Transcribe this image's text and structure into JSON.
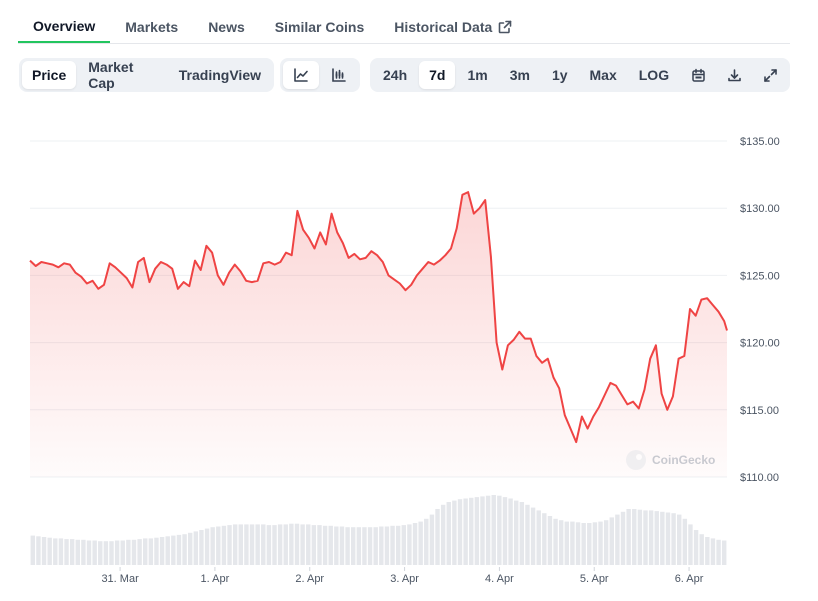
{
  "tabs": [
    {
      "label": "Overview",
      "active": true
    },
    {
      "label": "Markets"
    },
    {
      "label": "News"
    },
    {
      "label": "Similar Coins"
    },
    {
      "label": "Historical Data",
      "icon": "external-link-icon"
    }
  ],
  "chart_type_toggle": [
    "Price",
    "Market Cap",
    "TradingView"
  ],
  "chart_style_icons": [
    "line-chart-icon",
    "candlestick-chart-icon"
  ],
  "ranges": [
    "24h",
    "7d",
    "1m",
    "3m",
    "1y",
    "Max",
    "LOG"
  ],
  "selected_range": "7d",
  "tool_icons": [
    "calendar-icon",
    "download-icon",
    "expand-icon"
  ],
  "watermark": "CoinGecko",
  "colors": {
    "line": "#ef4444",
    "accent": "#22c55e",
    "volume": "#e5e7eb"
  },
  "chart_data": {
    "type": "area",
    "y_ticks": [
      "$135.00",
      "$130.00",
      "$125.00",
      "$120.00",
      "$115.00",
      "$110.00"
    ],
    "ylim": [
      110,
      135
    ],
    "x_ticks": [
      "31. Mar",
      "1. Apr",
      "2. Apr",
      "3. Apr",
      "4. Apr",
      "5. Apr",
      "6. Apr"
    ],
    "x_tick_positions_days": [
      0.95,
      1.95,
      2.95,
      3.95,
      4.95,
      5.95,
      6.95
    ],
    "x_range_days": [
      0.0,
      7.35
    ],
    "grid": true,
    "series": [
      {
        "x": [
          0.0,
          0.06,
          0.12,
          0.18,
          0.24,
          0.3,
          0.36,
          0.42,
          0.48,
          0.54,
          0.6,
          0.66,
          0.72,
          0.78,
          0.84,
          0.9,
          0.96,
          1.02,
          1.08,
          1.14,
          1.2,
          1.26,
          1.32,
          1.38,
          1.44,
          1.5,
          1.56,
          1.62,
          1.68,
          1.74,
          1.8,
          1.86,
          1.92,
          1.98,
          2.04,
          2.1,
          2.16,
          2.22,
          2.28,
          2.34,
          2.4,
          2.46,
          2.52,
          2.58,
          2.64,
          2.7,
          2.76,
          2.82,
          2.88,
          2.94,
          3.0,
          3.06,
          3.12,
          3.18,
          3.24,
          3.3,
          3.36,
          3.42,
          3.48,
          3.54,
          3.6,
          3.66,
          3.72,
          3.78,
          3.84,
          3.9,
          3.96,
          4.02,
          4.08,
          4.14,
          4.2,
          4.26,
          4.32,
          4.38,
          4.44,
          4.5,
          4.56,
          4.62,
          4.68,
          4.74,
          4.8,
          4.86,
          4.92,
          4.98,
          5.04,
          5.1,
          5.16,
          5.22,
          5.28,
          5.34,
          5.4,
          5.46,
          5.52,
          5.58,
          5.64,
          5.7,
          5.76,
          5.82,
          5.88,
          5.94,
          6.0,
          6.06,
          6.12,
          6.18,
          6.24,
          6.3,
          6.36,
          6.42,
          6.48,
          6.54,
          6.6,
          6.66,
          6.72,
          6.78,
          6.84,
          6.9,
          6.96,
          7.02,
          7.08,
          7.14,
          7.2,
          7.26,
          7.32,
          7.35
        ],
        "values": [
          126.1,
          125.7,
          126.0,
          125.9,
          125.8,
          125.6,
          125.9,
          125.8,
          125.2,
          124.9,
          124.4,
          124.6,
          124.0,
          124.3,
          125.9,
          125.6,
          125.2,
          124.8,
          124.1,
          126.0,
          126.3,
          124.5,
          125.5,
          126.0,
          125.8,
          125.5,
          124.0,
          124.5,
          124.2,
          126.1,
          125.4,
          127.2,
          126.7,
          125.0,
          124.3,
          125.2,
          125.8,
          125.3,
          124.6,
          124.5,
          124.6,
          125.9,
          126.0,
          125.8,
          126.0,
          126.7,
          126.5,
          129.8,
          128.4,
          127.8,
          127.0,
          128.2,
          127.3,
          129.6,
          128.2,
          127.4,
          126.3,
          126.6,
          126.2,
          126.3,
          126.8,
          126.5,
          126.0,
          125.0,
          124.7,
          124.4,
          123.9,
          124.3,
          125.0,
          125.5,
          126.0,
          125.8,
          126.1,
          126.5,
          127.0,
          128.5,
          131.0,
          131.2,
          129.6,
          130.0,
          130.6,
          126.4,
          120.0,
          118.0,
          119.8,
          120.2,
          120.8,
          120.3,
          120.3,
          119.0,
          118.5,
          118.8,
          117.4,
          116.6,
          114.6,
          113.6,
          112.6,
          114.5,
          113.6,
          114.5,
          115.2,
          116.1,
          117.0,
          116.8,
          116.1,
          115.4,
          115.6,
          115.1,
          116.5,
          118.8,
          119.8,
          116.2,
          115.0,
          116.0,
          118.8,
          119.0,
          122.5,
          122.0,
          123.2,
          123.3,
          122.8,
          122.3,
          121.6,
          120.9
        ],
        "volume_levels": [
          0.42,
          0.41,
          0.4,
          0.39,
          0.38,
          0.38,
          0.37,
          0.37,
          0.36,
          0.36,
          0.35,
          0.35,
          0.34,
          0.34,
          0.34,
          0.35,
          0.35,
          0.36,
          0.36,
          0.37,
          0.38,
          0.38,
          0.39,
          0.4,
          0.41,
          0.42,
          0.43,
          0.44,
          0.46,
          0.48,
          0.5,
          0.52,
          0.54,
          0.55,
          0.56,
          0.57,
          0.58,
          0.58,
          0.58,
          0.58,
          0.58,
          0.58,
          0.57,
          0.57,
          0.58,
          0.58,
          0.59,
          0.59,
          0.58,
          0.58,
          0.57,
          0.57,
          0.56,
          0.56,
          0.55,
          0.55,
          0.54,
          0.54,
          0.54,
          0.54,
          0.54,
          0.54,
          0.55,
          0.55,
          0.56,
          0.56,
          0.57,
          0.58,
          0.6,
          0.62,
          0.66,
          0.72,
          0.8,
          0.86,
          0.9,
          0.92,
          0.94,
          0.95,
          0.96,
          0.97,
          0.98,
          0.99,
          1.0,
          0.99,
          0.97,
          0.95,
          0.92,
          0.9,
          0.86,
          0.82,
          0.78,
          0.74,
          0.7,
          0.66,
          0.64,
          0.62,
          0.62,
          0.61,
          0.6,
          0.6,
          0.61,
          0.62,
          0.64,
          0.68,
          0.72,
          0.76,
          0.8,
          0.8,
          0.79,
          0.78,
          0.78,
          0.77,
          0.76,
          0.75,
          0.74,
          0.72,
          0.66,
          0.58,
          0.5,
          0.44,
          0.4,
          0.38,
          0.36,
          0.35
        ]
      }
    ]
  }
}
